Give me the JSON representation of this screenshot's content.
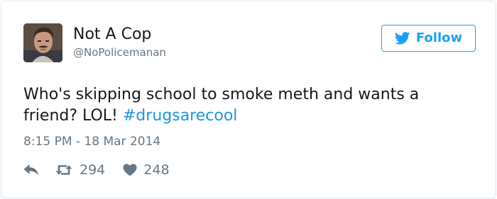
{
  "author": {
    "display_name": "Not A Cop",
    "username": "@NoPolicemanan"
  },
  "follow_button": {
    "label": "Follow"
  },
  "tweet": {
    "text_before_hashtag": "Who's skipping school to smoke meth and wants a friend? LOL! ",
    "hashtag": "#drugsarecool",
    "timestamp": "8:15 PM - 18 Mar 2014"
  },
  "actions": {
    "retweet_count": "294",
    "like_count": "248"
  },
  "icons": {
    "reply": "reply-icon",
    "retweet": "retweet-icon",
    "like": "heart-icon",
    "follow": "twitter-bird-icon"
  },
  "colors": {
    "twitter_blue": "#1da1f2",
    "hashtag_blue": "#1b95e0",
    "secondary_text": "#657786",
    "primary_text": "#14171a"
  }
}
